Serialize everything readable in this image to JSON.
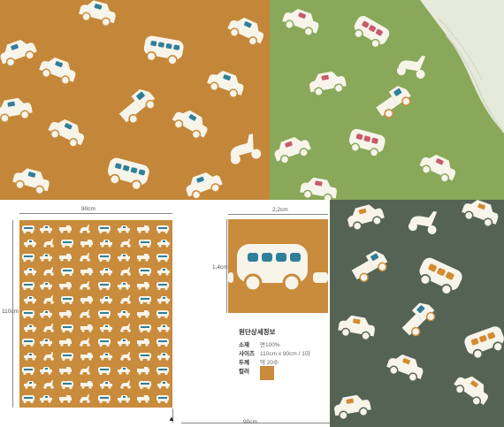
{
  "colors": {
    "mustard": "#c98b3c",
    "green": "#89a85a",
    "gray": "#586858",
    "print_white": "#f7f4ea",
    "print_blue": "#2f7f9a",
    "print_pink": "#c75a6b",
    "print_orange": "#d48a2e"
  },
  "dimensions": {
    "width_label": "90cm",
    "height_label": "110cm",
    "detail_width_label": "2,2cm",
    "detail_height_label": "1,4cm",
    "bottom_label": "90cm"
  },
  "fabric_details": {
    "title": "원단상세정보",
    "rows": [
      {
        "label": "소재",
        "value": "면100%"
      },
      {
        "label": "사이즈",
        "value": "110cm x 90cm / 1마"
      },
      {
        "label": "두께",
        "value": "약 20수"
      },
      {
        "label": "컬러",
        "value": ""
      }
    ]
  },
  "icons": [
    "car-print-icon",
    "bus-print-icon",
    "truck-print-icon",
    "scooter-print-icon"
  ]
}
